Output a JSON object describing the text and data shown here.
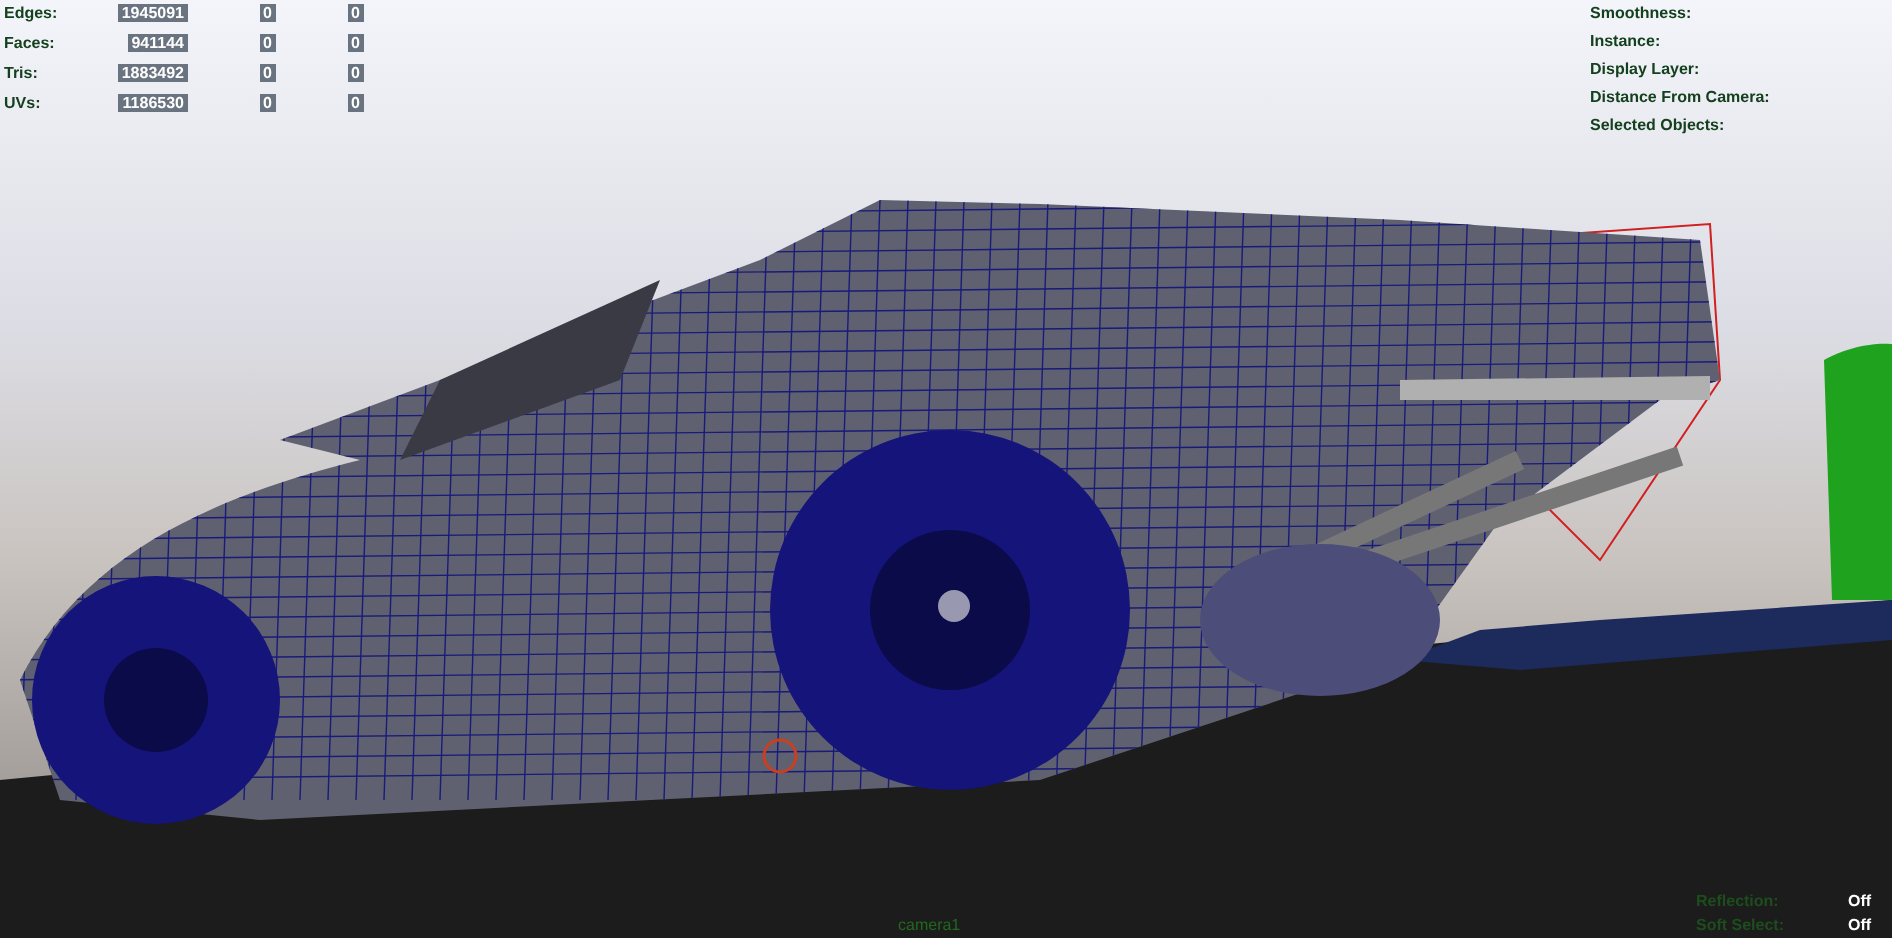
{
  "stats": [
    {
      "label": "Edges:",
      "values": [
        "1945091",
        "0",
        "0"
      ]
    },
    {
      "label": "Faces:",
      "values": [
        "941144",
        "0",
        "0"
      ]
    },
    {
      "label": "Tris:",
      "values": [
        "1883492",
        "0",
        "0"
      ]
    },
    {
      "label": "UVs:",
      "values": [
        "1186530",
        "0",
        "0"
      ]
    }
  ],
  "object_info": [
    "Smoothness:",
    "Instance:",
    "Display Layer:",
    "Distance From Camera:",
    "Selected Objects:"
  ],
  "camera_name": "camera1",
  "settings": [
    {
      "label": "Reflection:",
      "value": "Off"
    },
    {
      "label": "Soft Select:",
      "value": "Off"
    }
  ]
}
